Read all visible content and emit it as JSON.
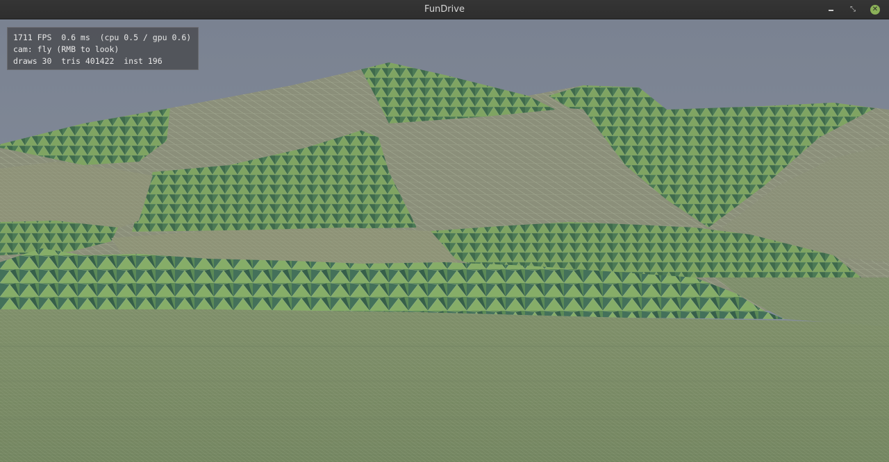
{
  "window": {
    "title": "FunDrive",
    "controls": {
      "minimize_icon": "minimize-icon",
      "maximize_icon": "maximize-icon",
      "close_icon": "close-icon",
      "maximize_glyph": "⤡",
      "close_glyph": "✕"
    }
  },
  "hud": {
    "line1": "1711 FPS  0.6 ms  (cpu 0.5 / gpu 0.6)",
    "line2": "cam: fly (RMB to look)",
    "line3": "draws 30  tris 401422  inst 196"
  },
  "scene": {
    "sky_color": "#7f8795",
    "ground_color": "#7a8c66",
    "grass_light": "#8aa86a",
    "grass_dark": "#3f6a4c",
    "wire_color": "#c9d3b7"
  }
}
